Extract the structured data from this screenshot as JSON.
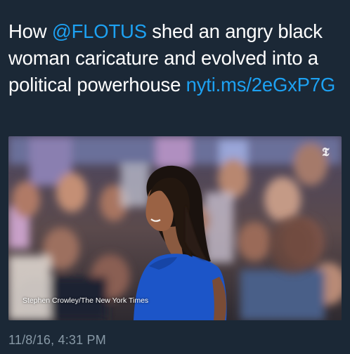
{
  "tweet": {
    "text_before": "How ",
    "mention": "@FLOTUS",
    "text_middle": " shed an angry black woman caricature and evolved into a political powerhouse ",
    "link": "nyti.ms/2eGxP7G",
    "timestamp": "11/8/16, 4:31 PM"
  },
  "media": {
    "photo_credit": "Stephen Crowley/The New York Times",
    "watermark_logo": "The New York Times T logo"
  },
  "colors": {
    "background": "#1b2836",
    "link": "#1da1f2",
    "timestamp": "#8899a6",
    "dress": "#1c55c8"
  }
}
